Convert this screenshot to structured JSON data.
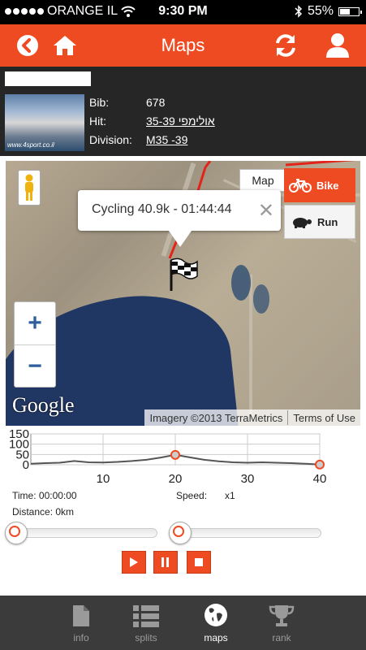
{
  "status": {
    "carrier": "ORANGE IL",
    "time": "9:30 PM",
    "battery": "55%",
    "battery_level": 0.55
  },
  "header": {
    "title": "Maps",
    "icons": [
      "back-icon",
      "home-icon",
      "refresh-icon",
      "user-icon"
    ]
  },
  "athlete": {
    "name": "",
    "photo_caption": "www.4sport.co.il",
    "bib_label": "Bib:",
    "bib": "678",
    "hit_label": "Hit:",
    "hit": "35-39 אולימפי",
    "division_label": "Division:",
    "division": "M35 -39"
  },
  "map": {
    "popup_text": "Cycling 40.9k - 01:44:44",
    "map_type": "Map",
    "mode_bike": "Bike",
    "mode_run": "Run",
    "zoom_in": "+",
    "zoom_out": "−",
    "google": "Google",
    "imagery": "Imagery ©2013 TerraMetrics",
    "terms": "Terms of Use"
  },
  "chart_data": {
    "type": "line",
    "x": [
      0,
      2,
      4,
      6,
      8,
      10,
      12,
      14,
      16,
      18,
      20,
      22,
      24,
      26,
      28,
      30,
      32,
      34,
      36,
      38,
      40
    ],
    "values": [
      5,
      8,
      10,
      18,
      12,
      11,
      14,
      18,
      24,
      35,
      48,
      36,
      24,
      17,
      12,
      10,
      12,
      10,
      8,
      5,
      1
    ],
    "xlim": [
      0,
      40
    ],
    "ylim": [
      0,
      150
    ],
    "yticks": [
      "150",
      "100",
      "50",
      "0"
    ],
    "xticks": [
      "10",
      "20",
      "30",
      "40"
    ],
    "markers_x": [
      20,
      40
    ],
    "line_color": "#555555",
    "marker_color": "#ef4b23"
  },
  "playback": {
    "time_label": "Time: 00:00:00",
    "speed_label": "Speed:",
    "speed_value": "x1",
    "distance_label": "Distance: 0km",
    "slider1_value": 0,
    "slider2_value": 0
  },
  "tabs": [
    {
      "label": "info",
      "icon": "document-icon",
      "active": false
    },
    {
      "label": "splits",
      "icon": "list-icon",
      "active": false
    },
    {
      "label": "maps",
      "icon": "globe-icon",
      "active": true
    },
    {
      "label": "rank",
      "icon": "trophy-icon",
      "active": false
    }
  ],
  "colors": {
    "accent": "#ef4b23",
    "panel": "#262626",
    "tabbar": "#3b3b3b"
  }
}
